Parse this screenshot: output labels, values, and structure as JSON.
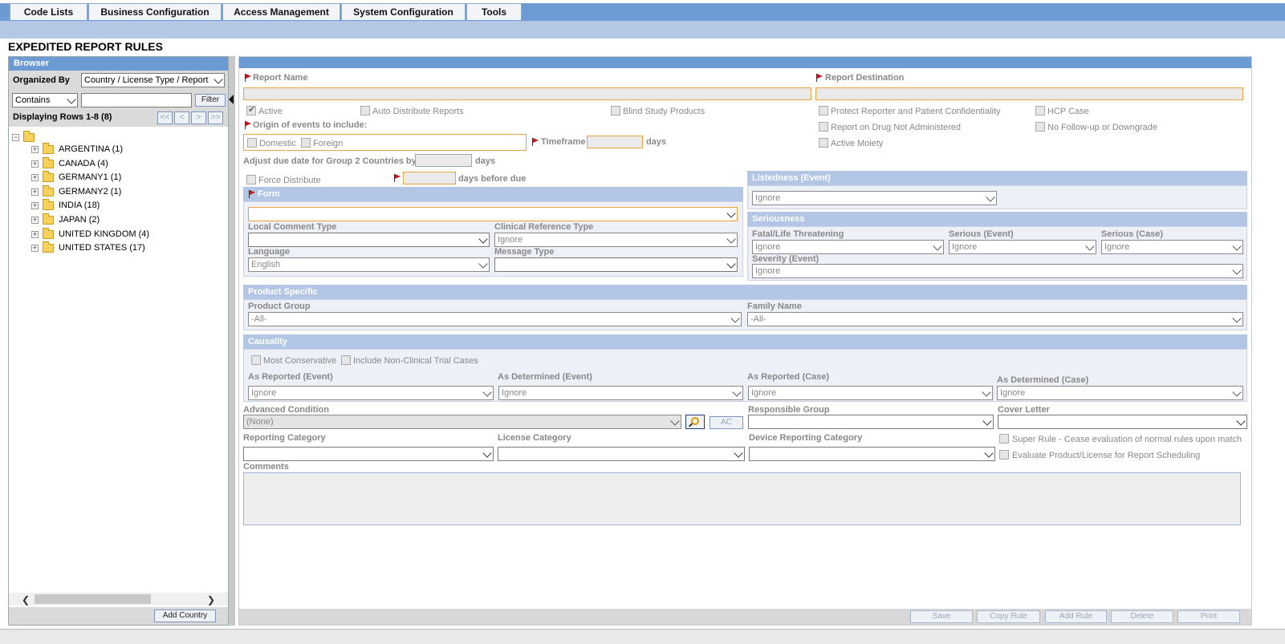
{
  "menu": {
    "items": [
      "Code Lists",
      "Business Configuration",
      "Access Management",
      "System Configuration",
      "Tools"
    ]
  },
  "page_title": "EXPEDITED REPORT RULES",
  "browser": {
    "header": "Browser",
    "organized_by_label": "Organized By",
    "organized_by_value": "Country / License Type / Report",
    "filter_mode": "Contains",
    "filter_text": "",
    "filter_button": "Filter",
    "displaying": "Displaying Rows 1-8 (8)",
    "pager": [
      "<<",
      "<",
      ">",
      ">>"
    ],
    "tree": [
      "ARGENTINA (1)",
      "CANADA (4)",
      "GERMANY1 (1)",
      "GERMANY2 (1)",
      "INDIA (18)",
      "JAPAN (2)",
      "UNITED KINGDOM (4)",
      "UNITED STATES (17)"
    ],
    "add_button": "Add Country"
  },
  "form": {
    "report_name_label": "Report Name",
    "report_destination_label": "Report Destination",
    "active_label": "Active",
    "auto_distribute_label": "Auto Distribute Reports",
    "blind_study_label": "Blind Study Products",
    "protect_label": "Protect Reporter and Patient Confidentiality",
    "hcp_label": "HCP Case",
    "origin_label": "Origin of events to include:",
    "report_on_drug_label": "Report on Drug Not Administered",
    "no_followup_label": "No Follow-up or Downgrade",
    "domestic_label": "Domestic",
    "foreign_label": "Foreign",
    "timeframe_label": "Timeframe",
    "days": "days",
    "active_moiety_label": "Active Moiety",
    "adjust_label": "Adjust due date for Group 2 Countries by",
    "force_distribute_label": "Force Distribute",
    "days_before_due": "days before due",
    "listedness_header": "Listedness (Event)",
    "listedness_value": "Ignore",
    "form_header": "Form",
    "local_comment_label": "Local Comment Type",
    "clinical_ref_label": "Clinical Reference Type",
    "clinical_ref_value": "Ignore",
    "language_label": "Language",
    "language_value": "English",
    "message_type_label": "Message Type",
    "seriousness_header": "Seriousness",
    "fatal_label": "Fatal/Life Threatening",
    "fatal_value": "Ignore",
    "serious_event_label": "Serious (Event)",
    "serious_event_value": "Ignore",
    "serious_case_label": "Serious (Case)",
    "serious_case_value": "Ignore",
    "severity_label": "Severity (Event)",
    "severity_value": "Ignore",
    "product_header": "Product Specific",
    "product_group_label": "Product Group",
    "product_group_value": "-All-",
    "family_name_label": "Family Name",
    "family_name_value": "-All-",
    "causality_header": "Causality",
    "most_conservative_label": "Most Conservative",
    "include_non_clinical_label": "Include Non-Clinical Trial Cases",
    "as_reported_event_label": "As Reported (Event)",
    "as_reported_event_value": "Ignore",
    "as_determined_event_label": "As Determined (Event)",
    "as_determined_event_value": "Ignore",
    "as_reported_case_label": "As Reported (Case)",
    "as_reported_case_value": "Ignore",
    "as_determined_case_label": "As Determined (Case)",
    "as_determined_case_value": "Ignore",
    "advanced_label": "Advanced Condition",
    "advanced_value": "(None)",
    "ac_button": "AC",
    "responsible_label": "Responsible Group",
    "cover_letter_label": "Cover Letter",
    "reporting_cat_label": "Reporting Category",
    "license_cat_label": "License Category",
    "device_cat_label": "Device Reporting Category",
    "super_rule_label": "Super Rule - Cease evaluation of normal rules upon match",
    "evaluate_label": "Evaluate Product/License for Report Scheduling",
    "comments_label": "Comments"
  },
  "buttons": [
    "Save",
    "Copy Rule",
    "Add Rule",
    "Delete",
    "Print"
  ]
}
